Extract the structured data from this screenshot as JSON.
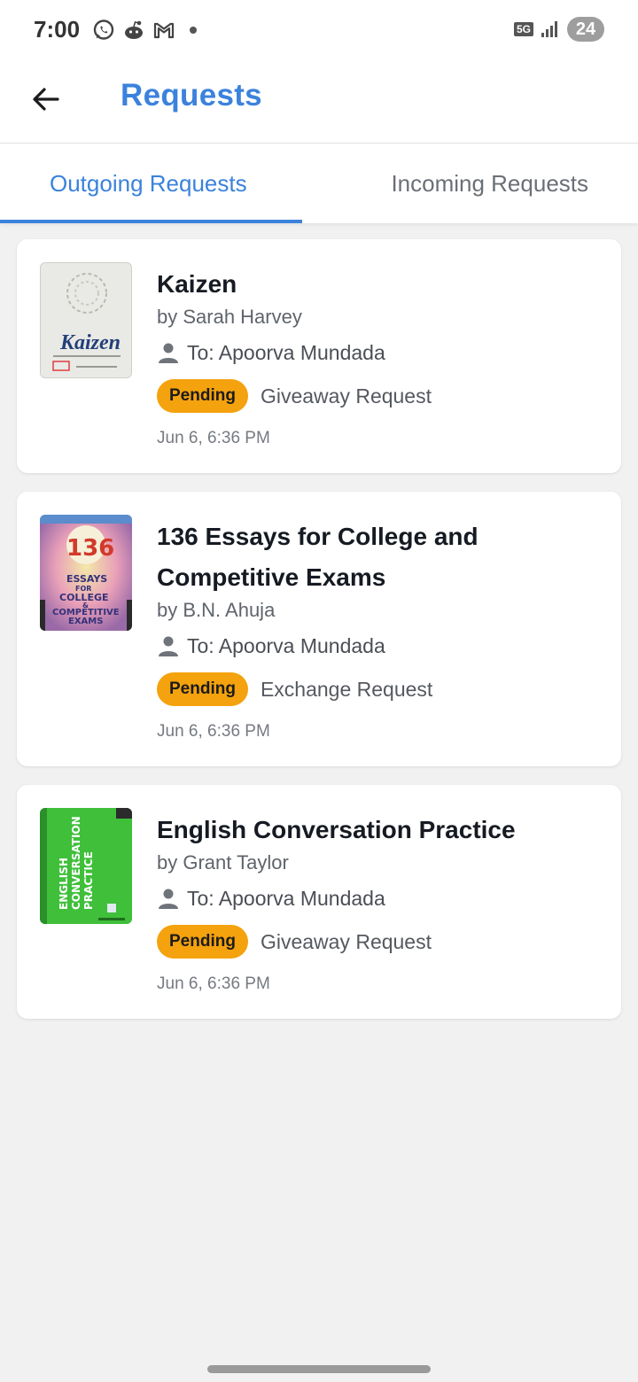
{
  "status_bar": {
    "time": "7:00",
    "network": "5G",
    "battery": "24",
    "icons_left": [
      "whatsapp-icon",
      "reddit-icon",
      "gmail-icon"
    ]
  },
  "header": {
    "title": "Requests",
    "back_icon": "arrow-left-icon"
  },
  "tabs": [
    {
      "label": "Outgoing Requests",
      "active": true
    },
    {
      "label": "Incoming Requests",
      "active": false
    }
  ],
  "colors": {
    "accent": "#3b82dc",
    "pending_badge": "#f4a20d",
    "background": "#f1f1f1"
  },
  "requests": [
    {
      "title": "Kaizen",
      "author": "by Sarah Harvey",
      "recipient": "To: Apoorva Mundada",
      "status": "Pending",
      "type": "Giveaway Request",
      "date": "Jun 6, 6:36 PM",
      "cover_text": "Kaizen"
    },
    {
      "title_line1": "136 Essays for College and",
      "title_line2": "Competitive Exams",
      "author": "by B.N. Ahuja",
      "recipient": "To: Apoorva Mundada",
      "status": "Pending",
      "type": "Exchange Request",
      "date": "Jun 6, 6:36 PM",
      "cover_text": "136"
    },
    {
      "title": "English Conversation Practice",
      "author": "by Grant Taylor",
      "recipient": "To: Apoorva Mundada",
      "status": "Pending",
      "type": "Giveaway Request",
      "date": "Jun 6, 6:36 PM",
      "cover_text": "ENGLISH CONVERSATION PRACTICE"
    }
  ]
}
